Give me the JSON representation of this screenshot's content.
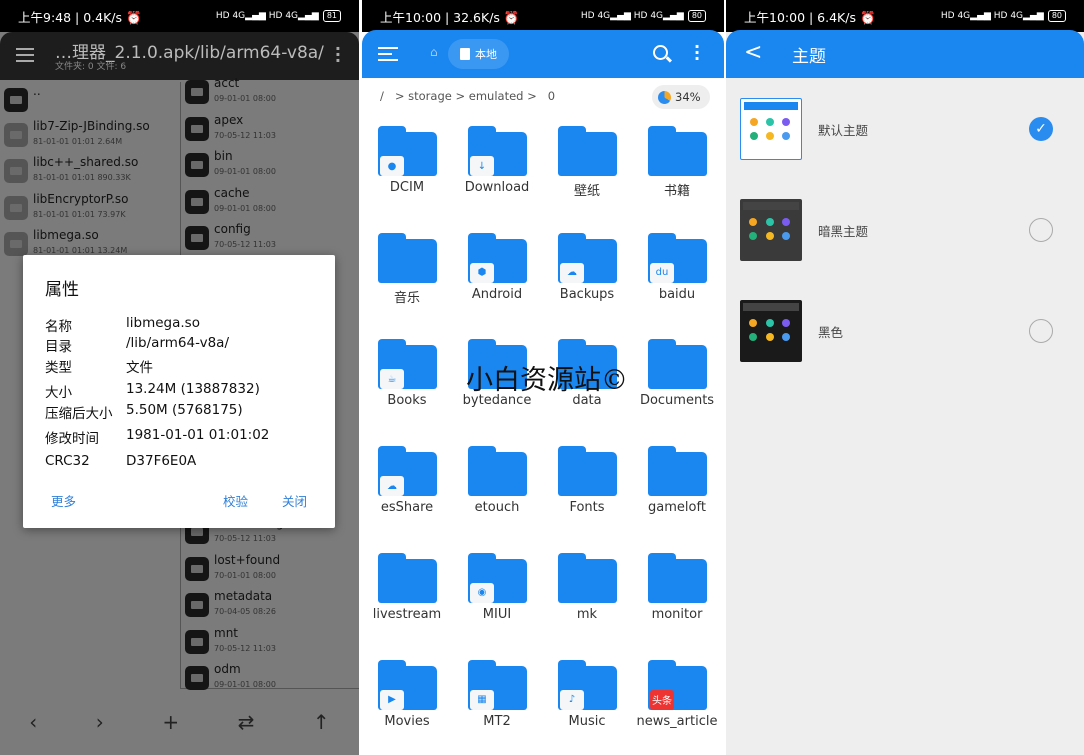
{
  "left": {
    "status": {
      "time": "上午9:48 | 0.4K/s ⏰",
      "battery": "81"
    },
    "title": "…理器_2.1.0.apk/lib/arm64-v8a/",
    "subtitle": "文件夹: 0  文件: 6",
    "left_list": [
      {
        "name": "..",
        "meta": "",
        "type": "folder"
      },
      {
        "name": "lib7-Zip-JBinding.so",
        "meta": "81-01-01 01:01  2.64M",
        "type": "file"
      },
      {
        "name": "libc++_shared.so",
        "meta": "81-01-01 01:01  890.33K",
        "type": "file"
      },
      {
        "name": "libEncryptorP.so",
        "meta": "81-01-01 01:01  73.97K",
        "type": "file"
      },
      {
        "name": "libmega.so",
        "meta": "81-01-01 01:01  13.24M",
        "type": "file"
      }
    ],
    "right_list_top": [
      {
        "name": "acct",
        "meta": "09-01-01 08:00"
      },
      {
        "name": "apex",
        "meta": "70-05-12 11:03"
      },
      {
        "name": "bin",
        "meta": "09-01-01 08:00"
      },
      {
        "name": "cache",
        "meta": "09-01-01 08:00"
      },
      {
        "name": "config",
        "meta": "70-05-12 11:03"
      }
    ],
    "right_list_bottom": [
      {
        "name": "linkerconfig",
        "meta": "70-05-12 11:03"
      },
      {
        "name": "lost+found",
        "meta": "70-01-01 08:00"
      },
      {
        "name": "metadata",
        "meta": "70-04-05 08:26"
      },
      {
        "name": "mnt",
        "meta": "70-05-12 11:03"
      },
      {
        "name": "odm",
        "meta": "09-01-01 08:00"
      }
    ],
    "nav": [
      "‹",
      "›",
      "+",
      "⇄",
      "↑"
    ],
    "dialog": {
      "title": "属性",
      "props": [
        {
          "k": "名称",
          "v": "libmega.so"
        },
        {
          "k": "目录",
          "v": "/lib/arm64-v8a/"
        },
        {
          "k": "类型",
          "v": "文件"
        },
        {
          "k": "大小",
          "v": "13.24M (13887832)"
        },
        {
          "k": "压缩后大小",
          "v": "5.50M (5768175)"
        },
        {
          "k": "修改时间",
          "v": "1981-01-01 01:01:02"
        },
        {
          "k": "CRC32",
          "v": "D37F6E0A"
        }
      ],
      "more": "更多",
      "verify": "校验",
      "close": "关闭"
    }
  },
  "middle": {
    "status": {
      "time": "上午10:00 | 32.6K/s ⏰",
      "battery": "80"
    },
    "chip": "本地",
    "crumb": "/   > storage > emulated >   0",
    "storage_pct": "34%",
    "folders": [
      {
        "name": "DCIM",
        "badge": "●"
      },
      {
        "name": "Download",
        "badge": "↓"
      },
      {
        "name": "壁纸"
      },
      {
        "name": "书籍"
      },
      {
        "name": "音乐"
      },
      {
        "name": "Android",
        "badge": "⬢"
      },
      {
        "name": "Backups",
        "badge": "☁"
      },
      {
        "name": "baidu",
        "badge": "du"
      },
      {
        "name": "Books",
        "badge": "☕"
      },
      {
        "name": "bytedance"
      },
      {
        "name": "data"
      },
      {
        "name": "Documents"
      },
      {
        "name": "esShare",
        "badge": "☁"
      },
      {
        "name": "etouch"
      },
      {
        "name": "Fonts"
      },
      {
        "name": "gameloft"
      },
      {
        "name": "livestream"
      },
      {
        "name": "MIUI",
        "badge": "◉"
      },
      {
        "name": "mk"
      },
      {
        "name": "monitor"
      },
      {
        "name": "Movies",
        "badge": "▶"
      },
      {
        "name": "MT2",
        "badge": "▦"
      },
      {
        "name": "Music",
        "badge": "♪"
      },
      {
        "name": "news_article",
        "badge": "头条"
      }
    ],
    "watermark": "小白资源站©",
    "accent": "#1a86f0"
  },
  "right": {
    "status": {
      "time": "上午10:00 | 6.4K/s ⏰",
      "battery": "80"
    },
    "title": "主题",
    "themes": [
      {
        "name": "默认主题",
        "selected": true,
        "bg": "#ffffff"
      },
      {
        "name": "暗黑主题",
        "selected": false,
        "bg": "#3a3a3a"
      },
      {
        "name": "黑色",
        "selected": false,
        "bg": "#1a1a1a"
      }
    ]
  }
}
